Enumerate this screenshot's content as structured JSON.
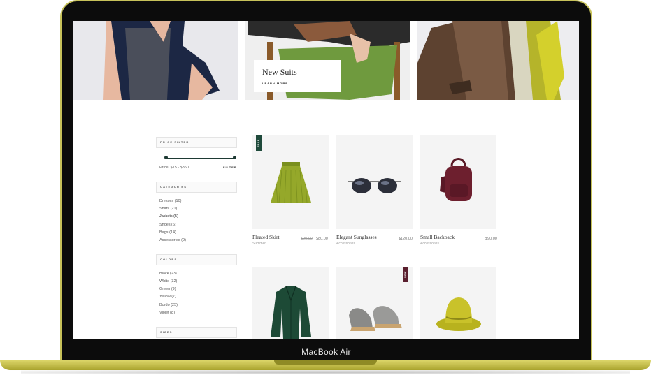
{
  "device": {
    "brand_label": "MacBook Air",
    "frame_color": "#c7c25a"
  },
  "promo": {
    "title": "New Suits",
    "link_label": "LEARN MORE"
  },
  "sidebar": {
    "price_filter": {
      "heading": "PRICE FILTER",
      "range_label": "Price: $15 - $350",
      "filter_button": "FILTER"
    },
    "categories": {
      "heading": "CATEGORIES",
      "items": [
        {
          "label": "Dresses (10)"
        },
        {
          "label": "Shirts (21)"
        },
        {
          "label": "Jackets (5)"
        },
        {
          "label": "Shoes (6)"
        },
        {
          "label": "Bags (14)"
        },
        {
          "label": "Accessories (9)"
        }
      ]
    },
    "colors": {
      "heading": "COLORS",
      "items": [
        {
          "label": "Black (23)"
        },
        {
          "label": "White (32)"
        },
        {
          "label": "Green (9)"
        },
        {
          "label": "Yellow (7)"
        },
        {
          "label": "Bordo (25)"
        },
        {
          "label": "Violet (8)"
        }
      ]
    },
    "sizes": {
      "heading": "SIZES"
    }
  },
  "products": [
    {
      "name": "Pleated Skirt",
      "category": "Summer",
      "old_price": "$90.00",
      "price": "$80.00",
      "badge": "SALE",
      "badge_color": "#1f4a3b",
      "icon": "skirt-icon"
    },
    {
      "name": "Elegant Sunglasses",
      "category": "Accessories",
      "price": "$120.00",
      "icon": "sunglasses-icon"
    },
    {
      "name": "Small Backpack",
      "category": "Accessories",
      "price": "$90.00",
      "icon": "backpack-icon"
    },
    {
      "name": "",
      "category": "",
      "price": "",
      "icon": "leather-jacket-icon"
    },
    {
      "name": "",
      "category": "",
      "price": "",
      "badge": "NEW",
      "badge_color": "#5a1f2e",
      "icon": "espadrilles-icon"
    },
    {
      "name": "",
      "category": "",
      "price": "",
      "icon": "hat-icon"
    }
  ]
}
